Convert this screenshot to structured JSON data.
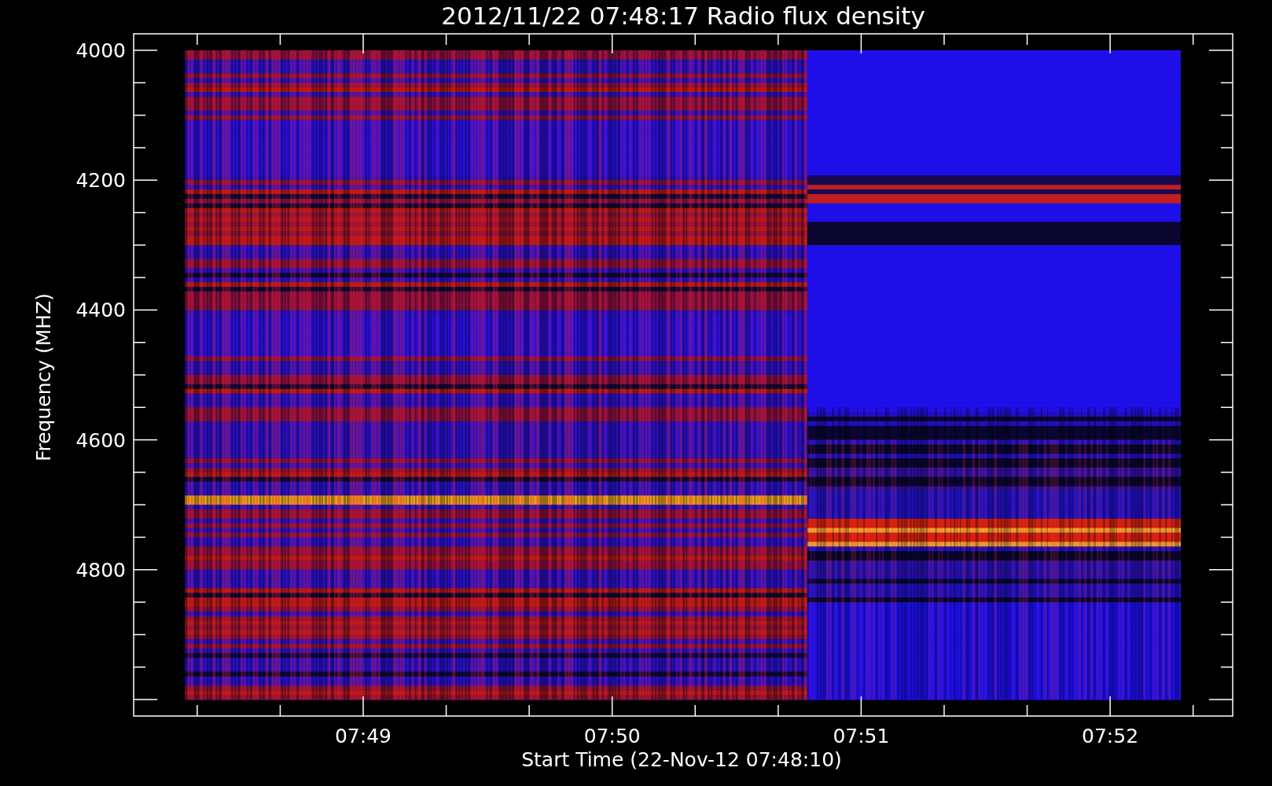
{
  "title": "2012/11/22 07:48:17 Radio flux density",
  "y_axis": {
    "label": "Frequency (MHZ)",
    "ticks": [
      "4000",
      "4200",
      "4400",
      "4600",
      "4800"
    ]
  },
  "x_axis": {
    "label": "Start Time (22-Nov-12 07:48:10)",
    "ticks": [
      "07:49",
      "07:50",
      "07:51",
      "07:52"
    ]
  }
}
